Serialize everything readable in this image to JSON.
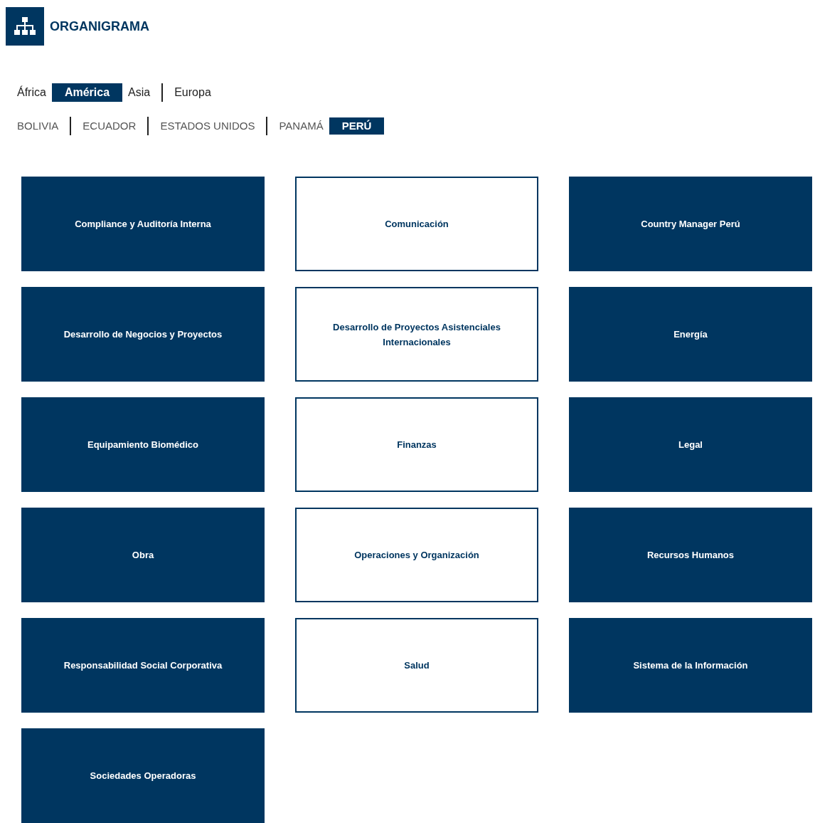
{
  "header": {
    "title": "ORGANIGRAMA"
  },
  "regions": [
    {
      "label": "África",
      "selected": false
    },
    {
      "label": "América",
      "selected": true
    },
    {
      "label": "Asia",
      "selected": false
    },
    {
      "label": "Europa",
      "selected": false
    }
  ],
  "countries": [
    {
      "label": "BOLIVIA",
      "selected": false
    },
    {
      "label": "ECUADOR",
      "selected": false
    },
    {
      "label": "ESTADOS UNIDOS",
      "selected": false
    },
    {
      "label": "PANAMÁ",
      "selected": false
    },
    {
      "label": "PERÚ",
      "selected": true
    }
  ],
  "department_rows": [
    {
      "departments": [
        {
          "label": "Compliance y Auditoría Interna",
          "kind": "filled"
        },
        {
          "label": "Comunicación",
          "kind": "outlined"
        },
        {
          "label": "Country Manager Perú",
          "kind": "filled"
        }
      ]
    },
    {
      "departments": [
        {
          "label": "Desarrollo de Negocios y Proyectos",
          "kind": "filled"
        },
        {
          "label": "Desarrollo de Proyectos Asistenciales Internacionales",
          "kind": "outlined"
        },
        {
          "label": "Energía",
          "kind": "filled"
        }
      ]
    },
    {
      "departments": [
        {
          "label": "Equipamiento Biomédico",
          "kind": "filled"
        },
        {
          "label": "Finanzas",
          "kind": "outlined"
        },
        {
          "label": "Legal",
          "kind": "filled"
        }
      ]
    },
    {
      "departments": [
        {
          "label": "Obra",
          "kind": "filled"
        },
        {
          "label": "Operaciones y Organización",
          "kind": "outlined"
        },
        {
          "label": "Recursos Humanos",
          "kind": "filled"
        }
      ]
    },
    {
      "departments": [
        {
          "label": "Responsabilidad Social Corporativa",
          "kind": "filled"
        },
        {
          "label": "Salud",
          "kind": "outlined"
        },
        {
          "label": "Sistema de la Información",
          "kind": "filled"
        }
      ]
    },
    {
      "departments": [
        {
          "label": "Sociedades Operadoras",
          "kind": "filled"
        }
      ]
    }
  ]
}
